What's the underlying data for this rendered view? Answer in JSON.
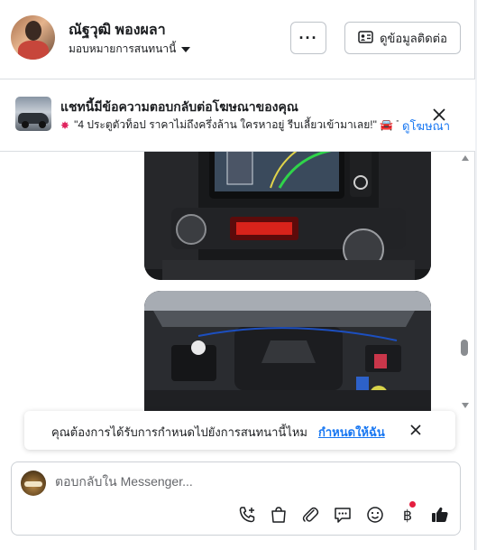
{
  "header": {
    "contact_name": "ณัฐวุฒิ พองผลา",
    "assign_label": "มอบหมายการสนทนานี้",
    "more_label": "···",
    "contact_info_label": "ดูข้อมูลติดต่อ"
  },
  "ad_banner": {
    "title": "แชทนี้มีข้อความตอบกลับต่อโฆษณาของคุณ",
    "snippet": "\"4 ประตูตัวท็อป ราคาไม่ถึงครึ่งล้าน ใครหาอยู่ รีบเลี้ยวเข้ามาเลย!\" 🚘 T...",
    "view_ad_label": "ดูโฆษณา"
  },
  "reminder": {
    "text": "คุณต้องการได้รับการกำหนดไปยังการสนทนานี้ไหม",
    "action_label": "กำหนดให้ฉัน"
  },
  "composer": {
    "placeholder": "ตอบกลับใน Messenger..."
  },
  "colors": {
    "accent": "#1877f2",
    "like": "#1c1e21",
    "notification_dot": "#e41e3f",
    "border": "#dadde1"
  },
  "icons": {
    "more": "more-dots-icon",
    "contact_card": "contact-card-icon",
    "close": "close-icon",
    "call": "phone-plus-icon",
    "shop": "shopping-bag-icon",
    "attach": "paperclip-icon",
    "saved_replies": "chat-bubble-dots-icon",
    "emoji": "smiley-icon",
    "payment": "baht-icon",
    "like": "thumbs-up-icon"
  }
}
